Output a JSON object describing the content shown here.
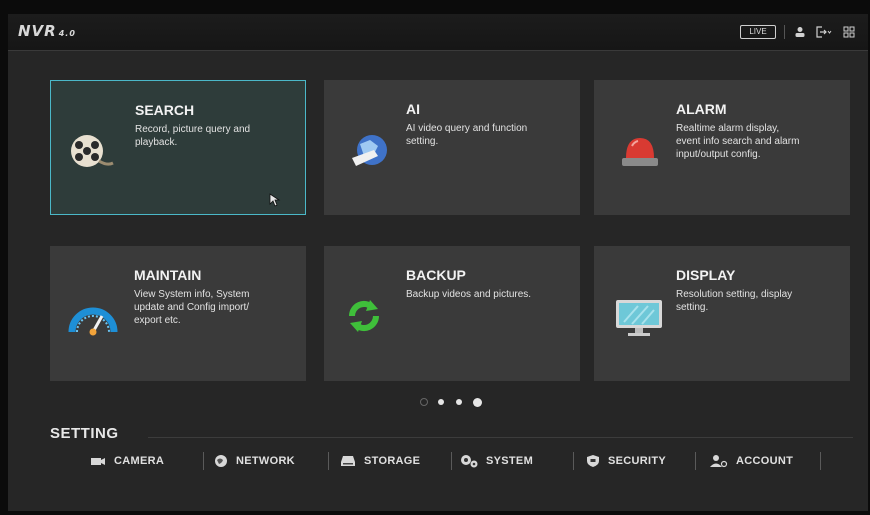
{
  "header": {
    "logo": "NVR",
    "version": "4.0",
    "live_label": "LIVE"
  },
  "tiles": [
    {
      "title": "SEARCH",
      "desc": [
        "Record, picture query and",
        "playback."
      ],
      "icon": "film-reel-icon"
    },
    {
      "title": "AI",
      "desc": [
        "AI video query and function",
        "setting."
      ],
      "icon": "ai-globe-icon"
    },
    {
      "title": "ALARM",
      "desc": [
        "Realtime alarm display,",
        "event info search and alarm",
        "input/output config."
      ],
      "icon": "alarm-light-icon"
    },
    {
      "title": "MAINTAIN",
      "desc": [
        "View System info, System",
        "update and Config import/",
        "export etc."
      ],
      "icon": "gauge-icon"
    },
    {
      "title": "BACKUP",
      "desc": [
        "Backup videos and pictures."
      ],
      "icon": "refresh-arrows-icon"
    },
    {
      "title": "DISPLAY",
      "desc": [
        "Resolution setting, display",
        "setting."
      ],
      "icon": "monitor-icon"
    }
  ],
  "setting": {
    "label": "SETTING",
    "items": [
      {
        "label": "CAMERA",
        "icon": "camera-icon"
      },
      {
        "label": "NETWORK",
        "icon": "globe-icon"
      },
      {
        "label": "STORAGE",
        "icon": "storage-icon"
      },
      {
        "label": "SYSTEM",
        "icon": "gears-icon"
      },
      {
        "label": "SECURITY",
        "icon": "shield-icon"
      },
      {
        "label": "ACCOUNT",
        "icon": "users-icon"
      }
    ]
  },
  "colors": {
    "accent": "#4bb8c8",
    "tile_bg": "#3a3a3a",
    "alarm_red": "#d93a32",
    "backup_green": "#3fbf3a"
  },
  "pager": {
    "pages": 2,
    "current": 1
  }
}
